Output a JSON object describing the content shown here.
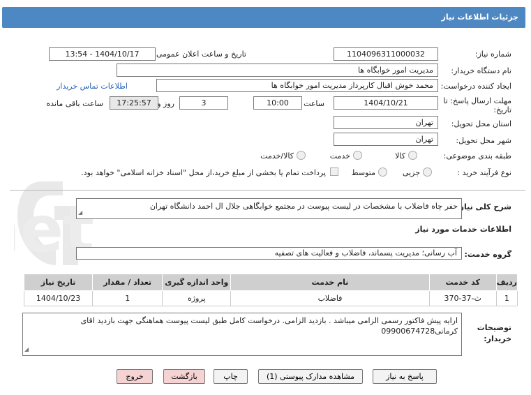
{
  "header": {
    "title": "جزئیات اطلاعات نیاز"
  },
  "form": {
    "need_number_label": "شماره نیاز:",
    "need_number": "1104096311000032",
    "announce_label": "تاریخ و ساعت اعلان عمومی:",
    "announce_value": "1404/10/17 - 13:54",
    "buyer_org_label": "نام دستگاه خریدار:",
    "buyer_org": "مدیریت امور خوابگاه ها",
    "creator_label": "ایجاد کننده درخواست:",
    "creator": "محمد خوش اقبال کارپرداز مدیریت امور خوابگاه ها",
    "contact_link": "اطلاعات تماس خریدار",
    "deadline_label_1": "مهلت ارسال پاسخ: تا",
    "deadline_label_2": "تاریخ:",
    "deadline_date": "1404/10/21",
    "time_label": "ساعت",
    "deadline_time": "10:00",
    "days": "3",
    "days_label": "روز و",
    "remaining": "17:25:57",
    "remaining_label": "ساعت باقی مانده",
    "province_label": "استان محل تحویل:",
    "province": "تهران",
    "city_label": "شهر محل تحویل:",
    "city": "تهران",
    "category_label": "طبقه بندی موضوعی:",
    "category_options": [
      "کالا",
      "خدمت",
      "کالا/خدمت"
    ],
    "purchase_type_label": "نوع فرآیند خرید :",
    "purchase_options": [
      "جزیی",
      "متوسط"
    ],
    "payment_note": "پرداخت تمام یا بخشی از مبلغ خرید،از محل \"اسناد خزانه اسلامی\" خواهد بود."
  },
  "summary": {
    "label": "شرح کلی نیاز:",
    "text": "حفر چاه فاضلاب با مشخصات در لیست پیوست در مجتمع خوابگاهی جلال ال احمد دانشگاه تهران"
  },
  "services": {
    "section_title": "اطلاعات خدمات مورد نیاز",
    "group_label": "گروه خدمت:",
    "group_value": "آب رسانی؛ مدیریت پسماند، فاضلاب و فعالیت های تصفیه",
    "columns": [
      "ردیف",
      "کد خدمت",
      "نام خدمت",
      "واحد اندازه گیری",
      "تعداد / مقدار",
      "تاریخ نیاز"
    ],
    "rows": [
      {
        "row": "1",
        "code": "ث-37-370",
        "name": "فاضلاب",
        "unit": "پروژه",
        "qty": "1",
        "date": "1404/10/23"
      }
    ]
  },
  "buyer_notes": {
    "label_1": "توضیحات",
    "label_2": "خریدار:",
    "text": "ارایه پیش فاکتور رسمی الزامی میباشد . بازدید الزامی. درخواست کامل طبق لیست پیوست هماهنگی جهت بازدید اقای کرمانی09900674728"
  },
  "buttons": {
    "reply": "پاسخ به نیاز",
    "attachments": "مشاهده مدارک پیوستی (1)",
    "print": "چاپ",
    "back": "بازگشت",
    "exit": "خروج"
  },
  "watermark": {
    "text": "AriaTender.net"
  }
}
